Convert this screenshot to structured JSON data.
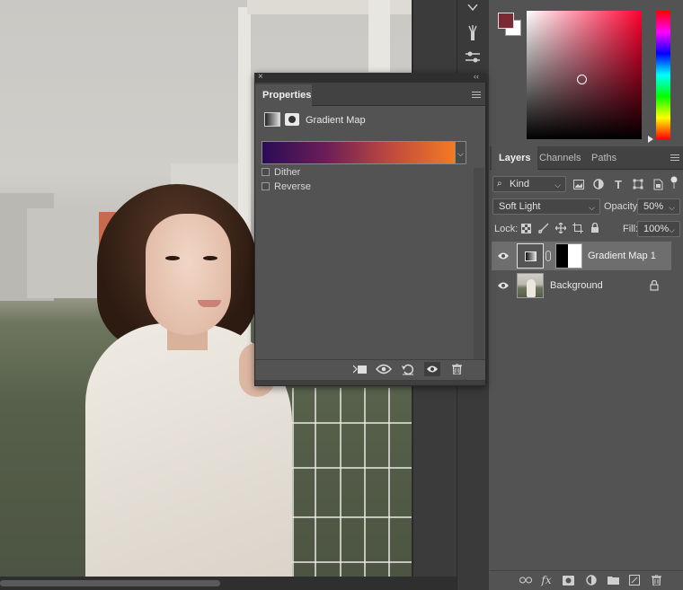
{
  "properties_panel": {
    "close_glyph": "×",
    "collapse_glyph": "‹‹",
    "tab_label": "Properties",
    "adjustment_title": "Gradient Map",
    "gradient_colors": [
      "#2a0c55",
      "#6b1e58",
      "#c04a3e",
      "#f47a24"
    ],
    "dither_label": "Dither",
    "reverse_label": "Reverse",
    "dither_checked": false,
    "reverse_checked": false,
    "footer_icons": [
      "clip-to-layer-icon",
      "view-previous-state-icon",
      "reset-icon",
      "visibility-icon",
      "delete-icon"
    ]
  },
  "color_panel": {
    "foreground_color": "#7a2a32",
    "background_color": "#ffffff"
  },
  "layers_panel": {
    "tabs": [
      "Layers",
      "Channels",
      "Paths"
    ],
    "active_tab": "Layers",
    "filter_kind": "Kind",
    "blend_mode": "Soft Light",
    "opacity_label": "Opacity:",
    "opacity_value": "50%",
    "lock_label": "Lock:",
    "fill_label": "Fill:",
    "fill_value": "100%",
    "filter_icons": [
      "pixel-layer-filter-icon",
      "adjustment-filter-icon",
      "type-filter-icon",
      "shape-filter-icon",
      "smart-object-filter-icon"
    ],
    "layers": [
      {
        "name": "Gradient Map 1",
        "selected": true,
        "visible": true
      },
      {
        "name": "Background",
        "selected": false,
        "visible": true,
        "locked": true
      }
    ],
    "footer_icons": [
      "link-layers-icon",
      "fx-icon",
      "add-mask-icon",
      "new-adjustment-icon",
      "new-group-icon",
      "new-layer-icon",
      "delete-layer-icon"
    ]
  }
}
